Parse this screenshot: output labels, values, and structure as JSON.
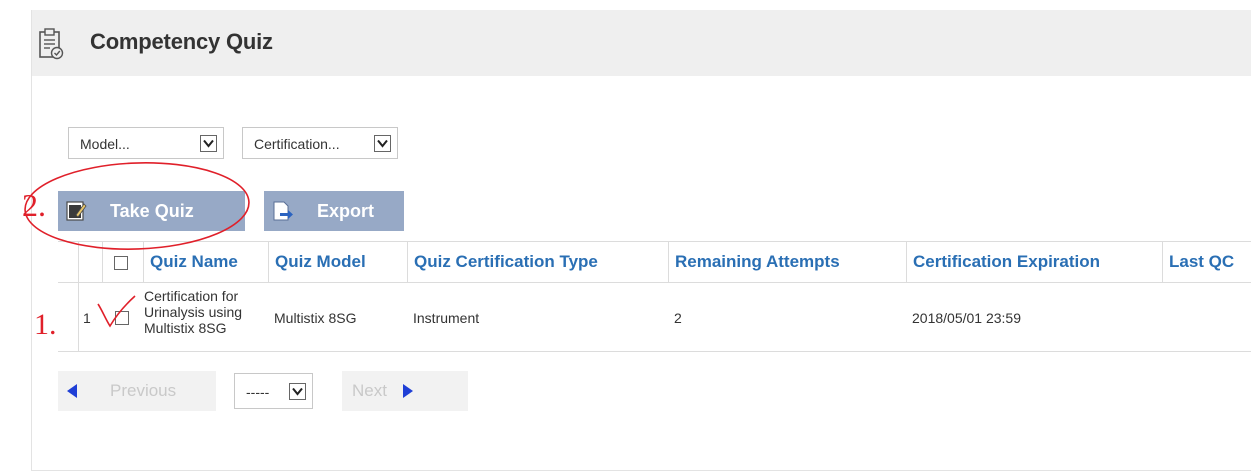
{
  "header": {
    "title": "Competency Quiz",
    "icon": "quiz-clipboard-icon"
  },
  "filters": {
    "model": {
      "selected": "Model..."
    },
    "certification": {
      "selected": "Certification..."
    }
  },
  "actions": {
    "take_quiz": "Take Quiz",
    "export": "Export"
  },
  "table": {
    "columns": [
      "Quiz Name",
      "Quiz Model",
      "Quiz Certification Type",
      "Remaining Attempts",
      "Certification Expiration",
      "Last QC"
    ],
    "rows": [
      {
        "index": "1",
        "quiz_name": [
          "Certification for",
          "Urinalysis using",
          "Multistix 8SG"
        ],
        "quiz_model": "Multistix 8SG",
        "certification_type": "Instrument",
        "remaining_attempts": "2",
        "certification_expiration": "2018/05/01 23:59",
        "last_qc": ""
      }
    ]
  },
  "pagination": {
    "previous": "Previous",
    "page_select": "-----",
    "next": "Next"
  },
  "annotations": {
    "step1": "1.",
    "step2": "2."
  },
  "colors": {
    "header_bg": "#efefef",
    "button_bg": "#97a9c6",
    "column_header": "#2a6fb4",
    "annotation": "#e0202a"
  }
}
